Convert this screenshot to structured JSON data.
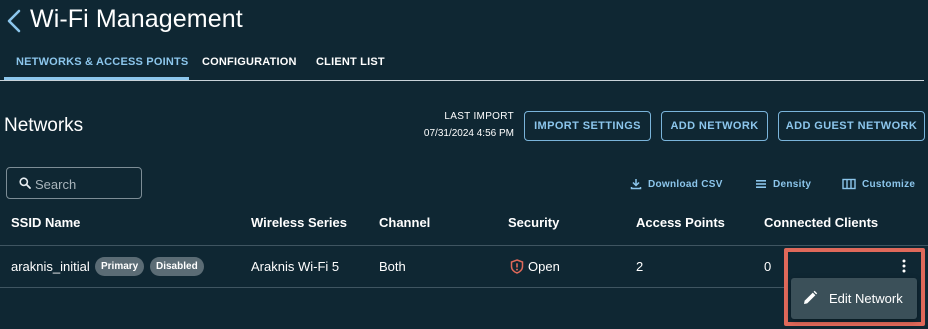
{
  "header": {
    "title": "Wi-Fi Management",
    "back_icon": "chevron-left-icon"
  },
  "tabs": [
    {
      "label": "Networks & Access Points",
      "active": true
    },
    {
      "label": "Configuration",
      "active": false
    },
    {
      "label": "Client List",
      "active": false
    }
  ],
  "section": {
    "title": "Networks",
    "last_import_label": "LAST IMPORT",
    "last_import_value": "07/31/2024 4:56 PM"
  },
  "actions": {
    "import_settings": "Import Settings",
    "add_network": "Add Network",
    "add_guest_network": "Add Guest Network"
  },
  "search": {
    "placeholder": "Search",
    "value": "",
    "icon": "search-icon"
  },
  "toolbar": {
    "download_csv": "Download CSV",
    "density": "Density",
    "customize": "Customize"
  },
  "table": {
    "columns": [
      "SSID Name",
      "Wireless Series",
      "Channel",
      "Security",
      "Access Points",
      "Connected Clients"
    ],
    "rows": [
      {
        "ssid": "araknis_initial",
        "badges": [
          "Primary",
          "Disabled"
        ],
        "wireless_series": "Araknis Wi-Fi 5",
        "channel": "Both",
        "security": "Open",
        "security_icon": "shield-alert-icon",
        "access_points": "2",
        "connected_clients": "0"
      }
    ]
  },
  "row_menu": {
    "icon": "pencil-icon",
    "label": "Edit Network"
  },
  "colors": {
    "background": "#0f2733",
    "accent": "#8cc6ec",
    "highlight": "#e0695a",
    "chip": "#5b6c75",
    "menu": "#3b5059",
    "security_warning": "#e0695a"
  }
}
